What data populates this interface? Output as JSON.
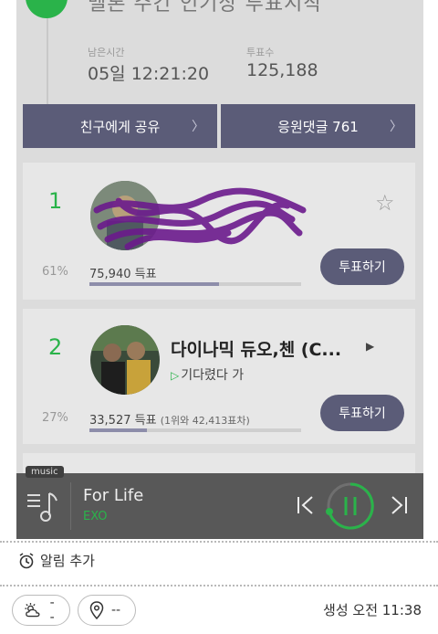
{
  "header": {
    "title": "멜론 주간 인기상 투표시작"
  },
  "stats": {
    "remaining_label": "남은시간",
    "remaining_value": "05일 12:21:20",
    "votes_label": "투표수",
    "votes_value": "125,188"
  },
  "actions": {
    "share_label": "친구에게 공유",
    "comments_label": "응원댓글 761"
  },
  "candidates": [
    {
      "rank": "1",
      "title": "",
      "artist": "",
      "percent": "61%",
      "votes": "75,940 득표",
      "gap_text": "",
      "vote_fraction": 0.61,
      "vote_button": "투표하기"
    },
    {
      "rank": "2",
      "title": "다이나믹 듀오,첸 (C...",
      "artist": "기다렸다 가",
      "percent": "27%",
      "votes": "33,527 득표",
      "gap_text": "(1위와 42,413표차)",
      "vote_fraction": 0.27,
      "vote_button": "투표하기"
    }
  ],
  "player": {
    "tag": "music",
    "title": "For Life",
    "artist": "EXO",
    "accent": "#2ab34a"
  },
  "footer": {
    "alarm_label": "알림 추가",
    "weather_value": "--",
    "location_value": "--",
    "created_label": "생성 오전 11:38"
  },
  "colors": {
    "accent_green": "#2ab34a",
    "button_slate": "#5b5c78"
  }
}
